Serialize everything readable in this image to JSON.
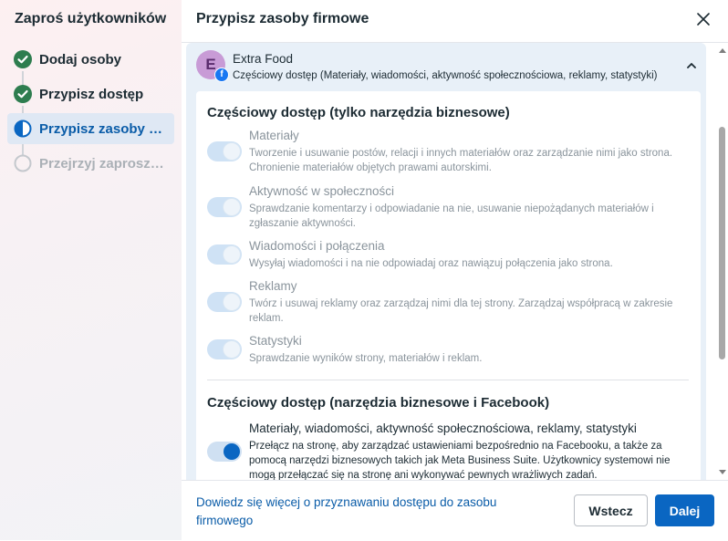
{
  "sidebar": {
    "title": "Zaproś użytkowników",
    "steps": [
      {
        "label": "Dodaj osoby",
        "state": "completed"
      },
      {
        "label": "Przypisz dostęp",
        "state": "completed"
      },
      {
        "label": "Przypisz zasoby firmowe",
        "state": "active"
      },
      {
        "label": "Przejrzyj zaproszenia",
        "state": "disabled"
      }
    ]
  },
  "header": {
    "title": "Przypisz zasoby firmowe"
  },
  "asset": {
    "avatar_letter": "E",
    "name": "Extra Food",
    "summary": "Częściowy dostęp (Materiały, wiadomości, aktywność społecznościowa, reklamy, statystyki)"
  },
  "sections": [
    {
      "title": "Częściowy dostęp (tylko narzędzia biznesowe)",
      "permissions": [
        {
          "name": "Materiały",
          "description": "Tworzenie i usuwanie postów, relacji i innych materiałów oraz zarządzanie nimi jako strona. Chronienie materiałów objętych prawami autorskimi.",
          "enabled": false
        },
        {
          "name": "Aktywność w społeczności",
          "description": "Sprawdzanie komentarzy i odpowiadanie na nie, usuwanie niepożądanych materiałów i zgłaszanie aktywności.",
          "enabled": false
        },
        {
          "name": "Wiadomości i połączenia",
          "description": "Wysyłaj wiadomości i na nie odpowiadaj oraz nawiązuj połączenia jako strona.",
          "enabled": false
        },
        {
          "name": "Reklamy",
          "description": "Twórz i usuwaj reklamy oraz zarządzaj nimi dla tej strony. Zarządzaj współpracą w zakresie reklam.",
          "enabled": false
        },
        {
          "name": "Statystyki",
          "description": "Sprawdzanie wyników strony, materiałów i reklam.",
          "enabled": false
        }
      ]
    },
    {
      "title": "Częściowy dostęp (narzędzia biznesowe i Facebook)",
      "permissions": [
        {
          "name": "Materiały, wiadomości, aktywność społecznościowa, reklamy, statystyki",
          "description": "Przełącz na stronę, aby zarządzać ustawieniami bezpośrednio na Facebooku, a także za pomocą narzędzi biznesowych takich jak Meta Business Suite. Użytkownicy systemowi nie mogą przełączać się na stronę ani wykonywać pewnych wrażliwych zadań.",
          "enabled": true
        }
      ]
    }
  ],
  "footer": {
    "learn_more": "Dowiedz się więcej o przyznawaniu dostępu do zasobu firmowego",
    "back_label": "Wstecz",
    "next_label": "Dalej"
  },
  "colors": {
    "accent": "#0a66c2",
    "success": "#2e7d4f"
  }
}
